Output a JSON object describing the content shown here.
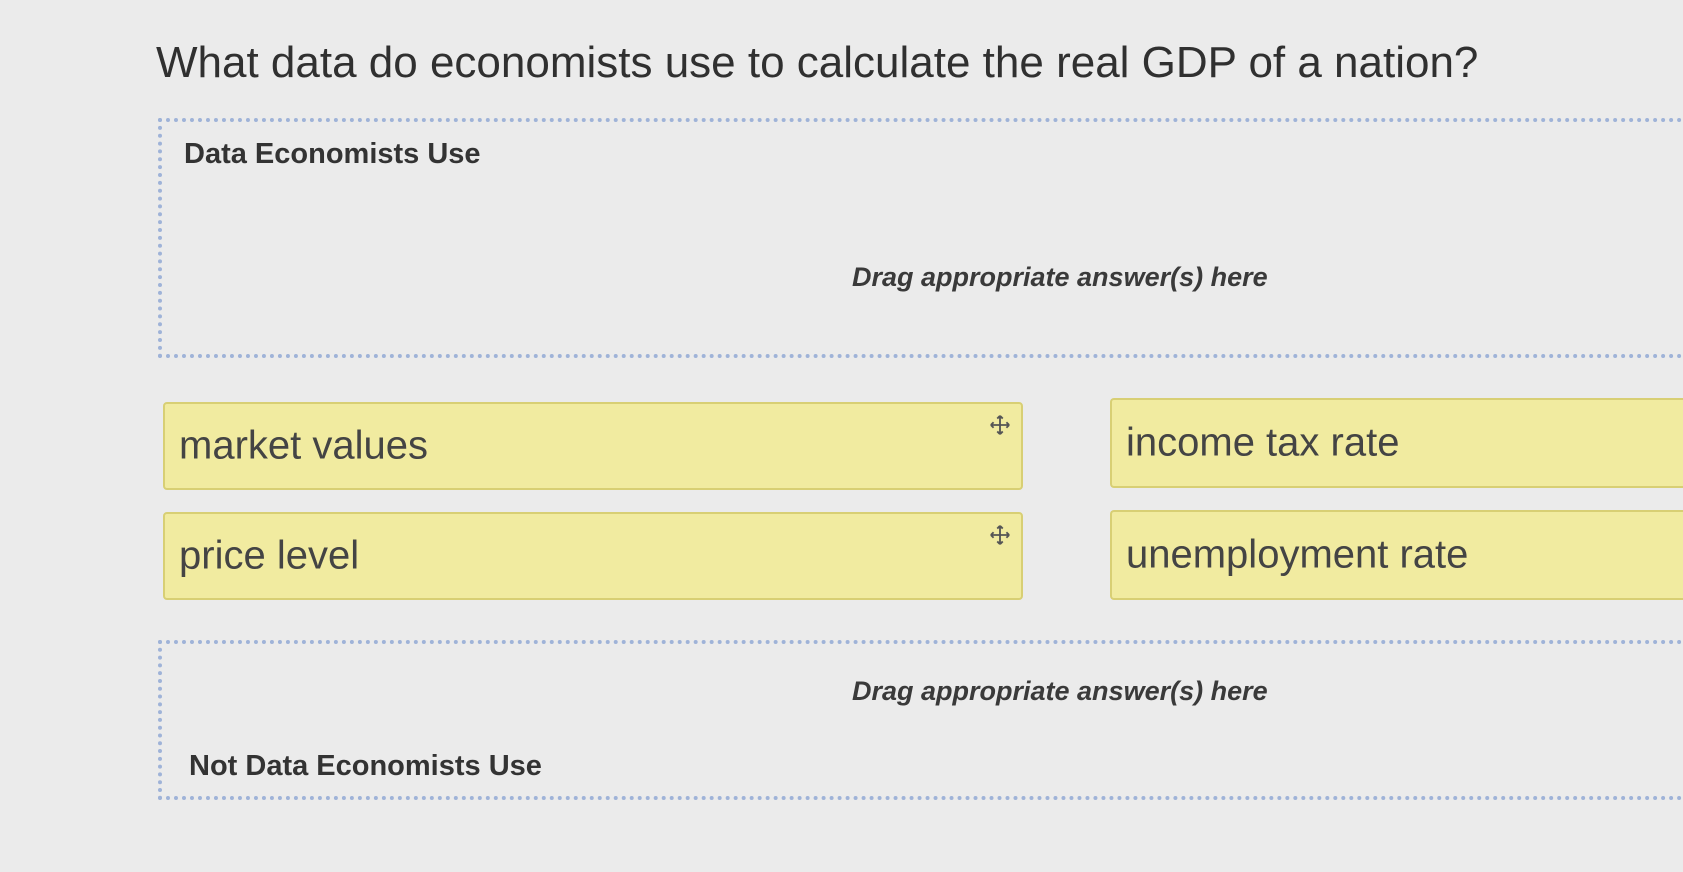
{
  "question": "What data do economists use to calculate the real GDP of a nation?",
  "zones": [
    {
      "title": "Data Economists Use",
      "hint": "Drag appropriate answer(s) here"
    },
    {
      "title": "Not Data Economists Use",
      "hint": "Drag appropriate answer(s) here"
    }
  ],
  "cards": [
    {
      "label": "market values",
      "icon": "move-icon"
    },
    {
      "label": "income tax rate"
    },
    {
      "label": "price level",
      "icon": "move-icon"
    },
    {
      "label": "unemployment rate"
    }
  ],
  "colors": {
    "card_bg": "#f1eba0",
    "zone_border": "#9fb3d8",
    "page_bg": "#ebebeb"
  }
}
